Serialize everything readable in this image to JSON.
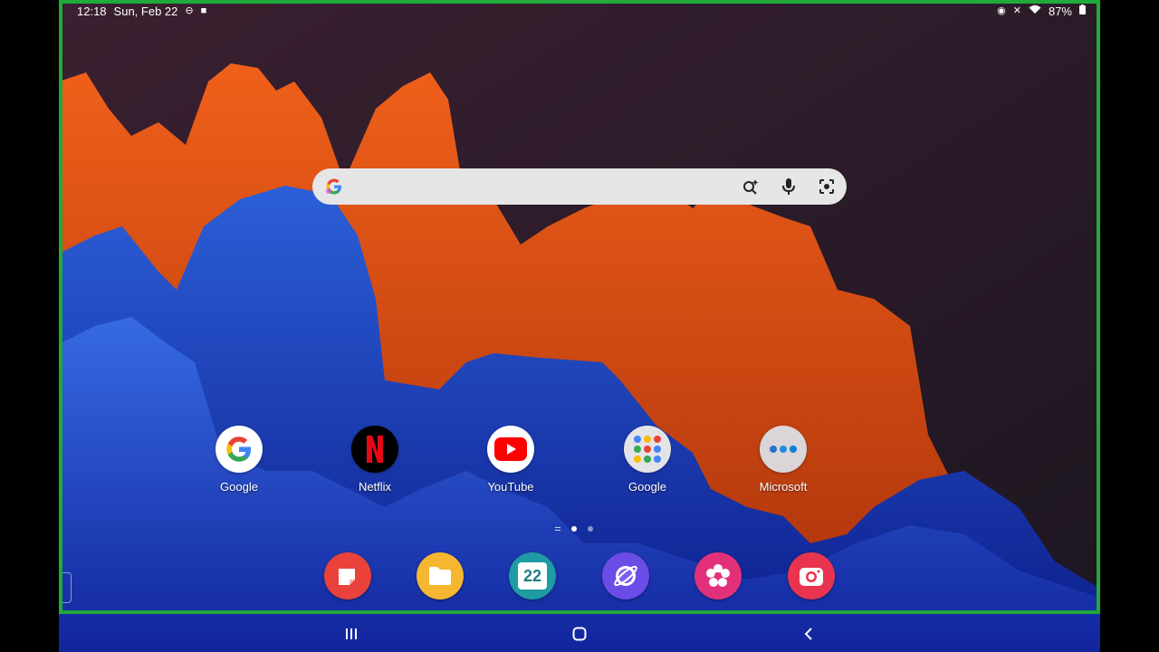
{
  "status_bar": {
    "time": "12:18",
    "date": "Sun, Feb 22",
    "battery": "87%"
  },
  "search": {
    "placeholder": ""
  },
  "apps": [
    {
      "label": "Google",
      "icon": "google-icon"
    },
    {
      "label": "Netflix",
      "icon": "netflix-icon"
    },
    {
      "label": "YouTube",
      "icon": "youtube-icon"
    },
    {
      "label": "Google",
      "icon": "google-folder-icon"
    },
    {
      "label": "Microsoft",
      "icon": "microsoft-folder-icon"
    }
  ],
  "dock": [
    {
      "icon": "samsung-notes-icon",
      "color": "#e8423a"
    },
    {
      "icon": "my-files-icon",
      "color": "#f5b731"
    },
    {
      "icon": "calendar-icon",
      "color": "#1f9ba3",
      "text": "22"
    },
    {
      "icon": "samsung-internet-icon",
      "color": "#6b4ce6"
    },
    {
      "icon": "bixby-gallery-icon",
      "color": "#e2317a"
    },
    {
      "icon": "camera-icon",
      "color": "#e8344f"
    }
  ],
  "page_indicator": {
    "pages": 2,
    "active": 1
  },
  "colors": {
    "frame": "#1faa3a",
    "search_bg": "#e6e6e6"
  }
}
